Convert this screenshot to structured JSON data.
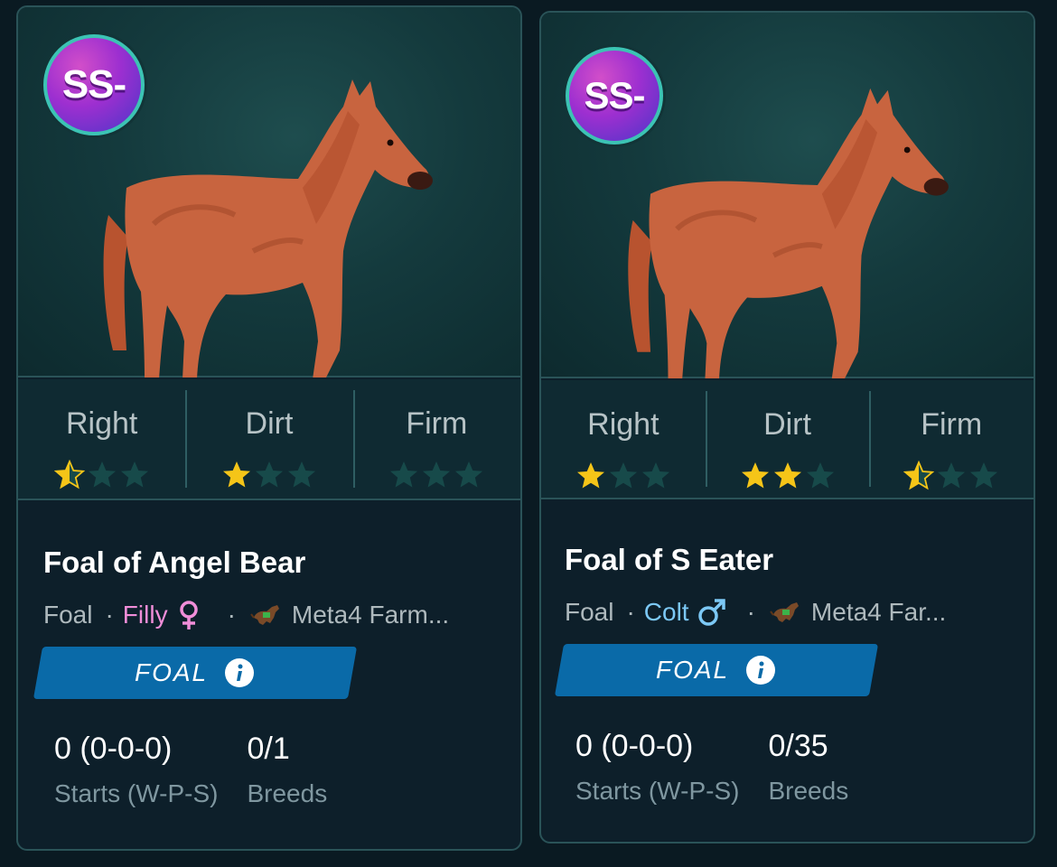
{
  "colors": {
    "card_border": "#2a5358",
    "card_bg": "#0d1f2a",
    "star_filled": "#f5c518",
    "star_empty": "#174a4a",
    "filly": "#f08dd8",
    "colt": "#7cc8f5",
    "foal_tag": "#0a6aa8"
  },
  "cards": [
    {
      "grade": "SS-",
      "ratings": [
        {
          "label": "Right",
          "stars": 0.5
        },
        {
          "label": "Dirt",
          "stars": 1
        },
        {
          "label": "Firm",
          "stars": 0
        }
      ],
      "name": "Foal of Angel Bear",
      "type": "Foal",
      "gender": "Filly",
      "gender_icon": "female-symbol-icon",
      "farm": "Meta4 Farm...",
      "farm_icon": "racehorse-icon",
      "status_tag": "FOAL",
      "starts_value": "0 (0-0-0)",
      "starts_label": "Starts (W-P-S)",
      "breeds_value": "0/1",
      "breeds_label": "Breeds"
    },
    {
      "grade": "SS-",
      "ratings": [
        {
          "label": "Right",
          "stars": 1
        },
        {
          "label": "Dirt",
          "stars": 2
        },
        {
          "label": "Firm",
          "stars": 0.5
        }
      ],
      "name": "Foal of S Eater",
      "type": "Foal",
      "gender": "Colt",
      "gender_icon": "male-symbol-icon",
      "farm": "Meta4 Far...",
      "farm_icon": "racehorse-icon",
      "status_tag": "FOAL",
      "starts_value": "0 (0-0-0)",
      "starts_label": "Starts (W-P-S)",
      "breeds_value": "0/35",
      "breeds_label": "Breeds"
    }
  ]
}
